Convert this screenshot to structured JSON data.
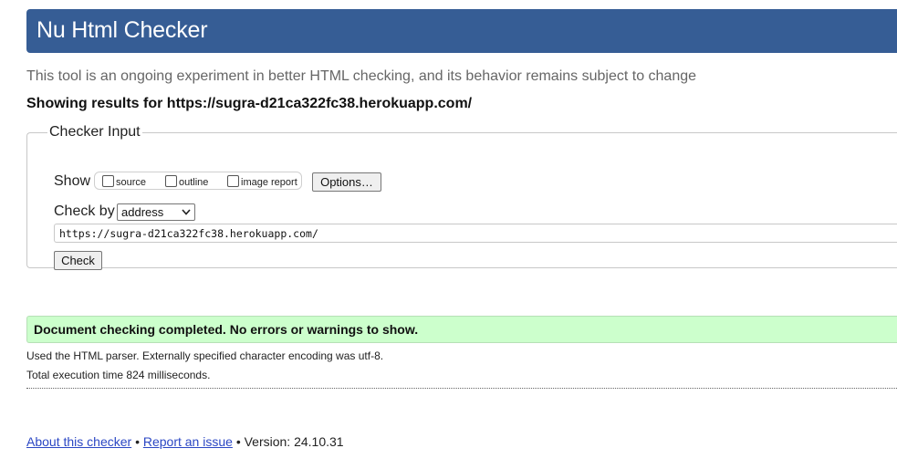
{
  "header": {
    "title": "Nu Html Checker"
  },
  "tagline": "This tool is an ongoing experiment in better HTML checking, and its behavior remains subject to change",
  "showing": "Showing results for https://sugra-d21ca322fc38.herokuapp.com/",
  "checker_input": {
    "legend": "Checker Input",
    "show_label": "Show",
    "options": [
      {
        "label": "source",
        "checked": false
      },
      {
        "label": "outline",
        "checked": false
      },
      {
        "label": "image report",
        "checked": false
      }
    ],
    "options_button": "Options…",
    "check_by_label": "Check by",
    "check_by_value": "address",
    "url_value": "https://sugra-d21ca322fc38.herokuapp.com/",
    "check_button": "Check"
  },
  "results": {
    "success": "Document checking completed. No errors or warnings to show.",
    "parser_info": "Used the HTML parser. Externally specified character encoding was utf-8.",
    "execution_time": "Total execution time 824 milliseconds."
  },
  "footer": {
    "about_link": "About this checker",
    "separator": "•",
    "report_link": "Report an issue",
    "version": "Version: 24.10.31"
  }
}
